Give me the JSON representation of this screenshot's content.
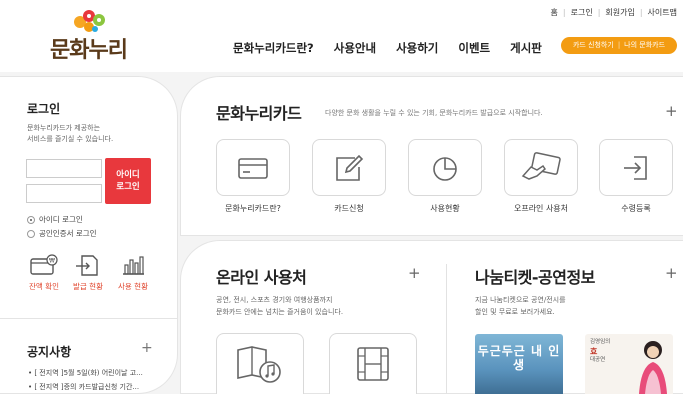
{
  "header": {
    "logo_text": "문화누리",
    "util_links": [
      "홈",
      "로그인",
      "회원가입",
      "사이트맵"
    ],
    "nav": [
      "문화누리카드란?",
      "사용안내",
      "사용하기",
      "이벤트",
      "게시판"
    ],
    "cta": {
      "left": "카드 신청하기",
      "right": "나의 문화카드"
    }
  },
  "login": {
    "title": "로그인",
    "desc_line1": "문화누리카드가 제공하는",
    "desc_line2": "서비스를 즐기실 수 있습니다.",
    "button_line1": "아이디",
    "button_line2": "로그인",
    "radio_id": "아이디 로그인",
    "radio_cert": "공인인증서 로그인",
    "quick": [
      "잔액 확인",
      "발급 현황",
      "사용 현황"
    ]
  },
  "notice": {
    "title": "공지사항",
    "items": [
      "• [ 전지역 ]5월 5일(화) 어린이날 고...",
      "• [ 전지역 ]증의 카드발급신청 기간..."
    ]
  },
  "card_section": {
    "title": "문화누리카드",
    "desc": "다양한 문화 생활을 누릴 수 있는 기회, 문화누리카드 발급으로 시작합니다.",
    "items": [
      "문화누리카드란?",
      "카드신청",
      "사용현황",
      "오프라인 사용처",
      "수령등록"
    ]
  },
  "online": {
    "title": "온라인 사용처",
    "desc_line1": "공연, 전시, 스포츠 경기와 여행상품까지",
    "desc_line2": "문화카드 안에는 넘치는 즐거움이 있습니다."
  },
  "nanum": {
    "title": "나눔티켓-공연정보",
    "desc_line1": "지금 나눔티켓으로 공연/전시를",
    "desc_line2": "할인 및 무료로 보러가세요.",
    "poster1_text": "두근두근 내 인생",
    "poster2_line1": "김영임의",
    "poster2_line2": "효",
    "poster2_line3": "대공연"
  },
  "colors": {
    "accent_orange": "#f39c12",
    "login_red": "#e8383d",
    "quick_red": "#e0442c",
    "brand_brown": "#5a3a1a"
  }
}
